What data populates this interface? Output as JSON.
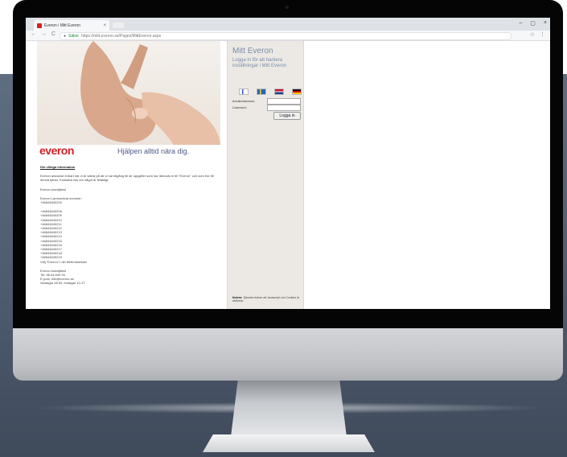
{
  "browser": {
    "tab_title": "Everon i Mitt Everon",
    "tab_close": "×",
    "url": "https://mitt.everon.se/Pages/MittEveron.aspx",
    "url_secure_label": "Säker",
    "window_controls": [
      "–",
      "▢",
      "×"
    ],
    "nav_icons": [
      "←",
      "→",
      "C"
    ]
  },
  "page": {
    "logo": "everon",
    "tagline": "Hjälpen alltid nära dig.",
    "info_heading": "Din viktiga information",
    "intro": "Everon ansvarar enbart när vi är säkra på att vi har tillgång till de uppgifter som har lämnats in till \"Everon\" och som hör till denna tjänst. Kontakta oss om något är felaktigt.",
    "contact_line": "Everon kundtjänst",
    "phones_heading": "Everon Larmcentral nummer:",
    "phones": [
      "+46844640200",
      "+46844640208",
      "+46844640209",
      "+46844640210",
      "+46844640211",
      "+46844640212",
      "+46844640213",
      "+46844640214",
      "+46844640215",
      "+46844640216",
      "+46844640217",
      "+46844640218",
      "+46844640219"
    ],
    "phones_note": "Välj \"Everon\" i din telefonkontakt",
    "support_heading": "Everon kundtjänst",
    "support_lines": [
      "Tel: 08-44 640 00",
      "E-post: info@everon.se",
      "Vardagar 08.00, lördagar 10-17"
    ]
  },
  "login_panel": {
    "title": "Mitt Everon",
    "subtitle": "Logga in för att hantera inställningar i Mitt Everon",
    "languages": [
      "Suomi",
      "Svenska",
      "English",
      "Deutsch"
    ],
    "username_label": "Användarnamn:",
    "password_label": "Lösenord:",
    "login_button": "Logga in",
    "notice_bold": "Notera:",
    "notice": "Tjänsten kräver att Javascript och Cookies är aktiverat."
  }
}
